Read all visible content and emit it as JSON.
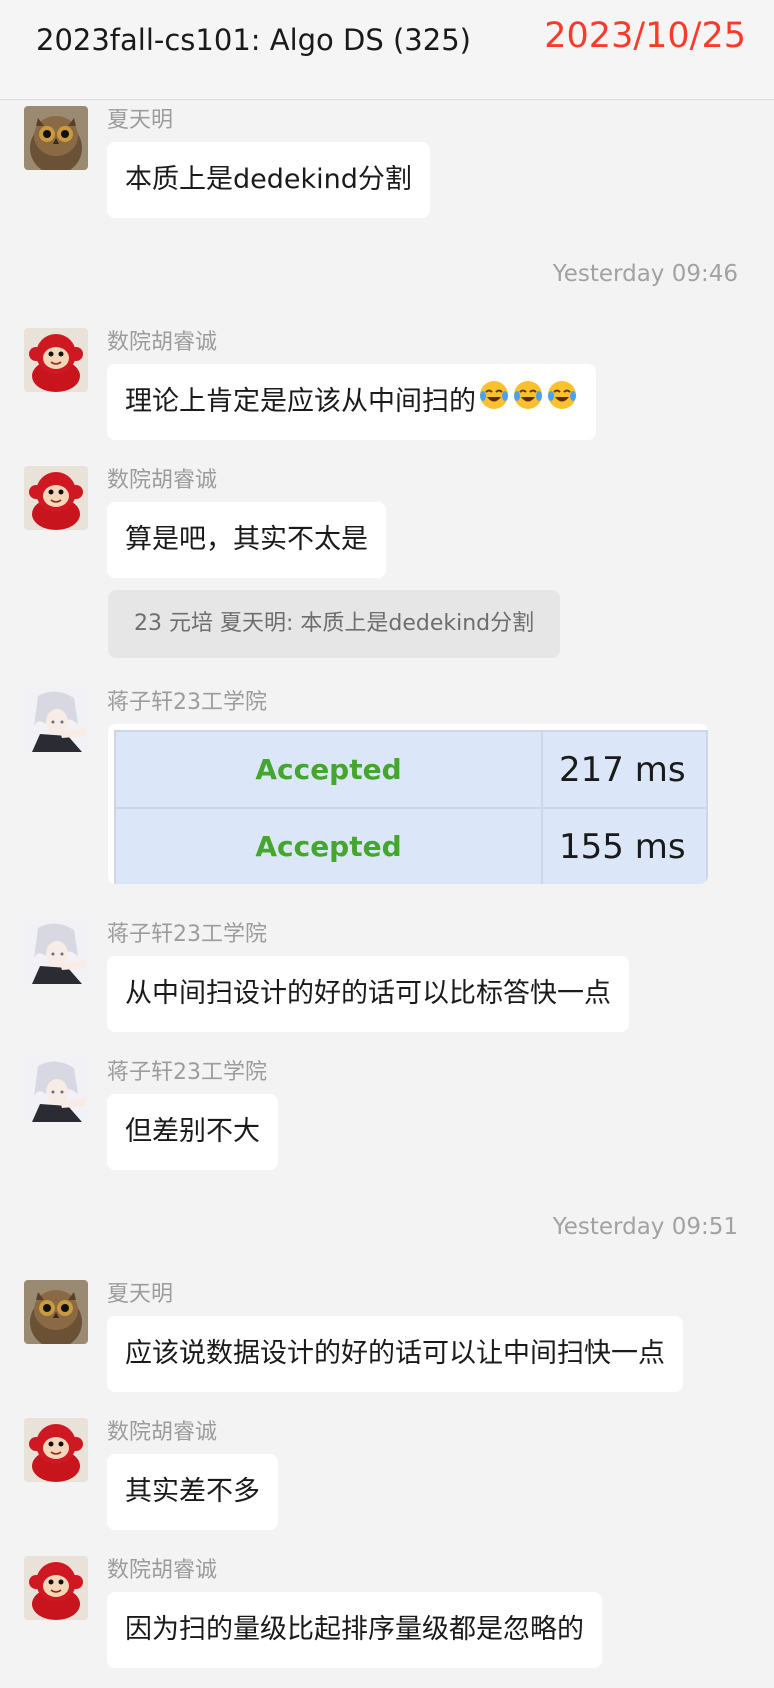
{
  "header": {
    "title": "2023fall-cs101: Algo DS  (325)",
    "date": "2023/10/25"
  },
  "timestamps": [
    "Yesterday 09:46",
    "Yesterday 09:51"
  ],
  "messages": [
    {
      "sender": "夏天明",
      "avatar": "owl-avatar",
      "text": "本质上是dedekind分割"
    },
    {
      "sender": "数院胡睿诚",
      "avatar": "monkey-avatar",
      "text": "理论上肯定是应该从中间扫的",
      "emoji": [
        "laughing-crying-emoji",
        "laughing-crying-emoji",
        "laughing-crying-emoji"
      ]
    },
    {
      "sender": "数院胡睿诚",
      "avatar": "monkey-avatar",
      "text": "算是吧，其实不太是",
      "quote": "23 元培 夏天明: 本质上是dedekind分割"
    },
    {
      "sender": "蒋子轩23工学院",
      "avatar": "anime-avatar",
      "image_rows": [
        {
          "status": "Accepted",
          "time": "217 ms"
        },
        {
          "status": "Accepted",
          "time": "155 ms"
        }
      ]
    },
    {
      "sender": "蒋子轩23工学院",
      "avatar": "anime-avatar",
      "text": "从中间扫设计的好的话可以比标答快一点"
    },
    {
      "sender": "蒋子轩23工学院",
      "avatar": "anime-avatar",
      "text": "但差别不大"
    },
    {
      "sender": "夏天明",
      "avatar": "owl-avatar",
      "text": "应该说数据设计的好的话可以让中间扫快一点"
    },
    {
      "sender": "数院胡睿诚",
      "avatar": "monkey-avatar",
      "text": "其实差不多"
    },
    {
      "sender": "数院胡睿诚",
      "avatar": "monkey-avatar",
      "text": "因为扫的量级比起排序量级都是忽略的"
    }
  ],
  "colors": {
    "date": "#fa3b2a",
    "accepted": "#44a62c",
    "background": "#f3f3f3",
    "bubble": "#ffffff"
  }
}
